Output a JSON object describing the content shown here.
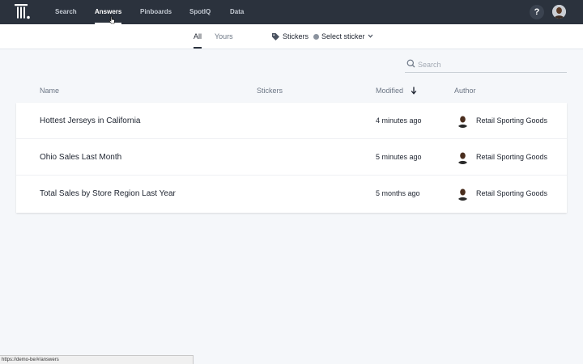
{
  "topnav": {
    "items": [
      {
        "label": "Search",
        "active": false
      },
      {
        "label": "Answers",
        "active": true
      },
      {
        "label": "Pinboards",
        "active": false
      },
      {
        "label": "SpotIQ",
        "active": false
      },
      {
        "label": "Data",
        "active": false
      }
    ],
    "help_label": "?",
    "icons": {
      "logo": "thoughtspot-logo",
      "help": "help-icon",
      "user": "user-avatar"
    }
  },
  "subnav": {
    "tabs": [
      {
        "label": "All",
        "active": true
      },
      {
        "label": "Yours",
        "active": false
      }
    ],
    "stickers_label": "Stickers",
    "select_sticker_label": "Select sticker"
  },
  "search": {
    "placeholder": "Search",
    "value": ""
  },
  "table": {
    "columns": {
      "name": "Name",
      "stickers": "Stickers",
      "modified": "Modified",
      "author": "Author"
    },
    "sort": {
      "column": "Modified",
      "direction": "descending"
    },
    "rows": [
      {
        "name": "Hottest Jerseys in California",
        "stickers": "",
        "modified": "4 minutes ago",
        "author": "Retail Sporting Goods"
      },
      {
        "name": "Ohio Sales Last Month",
        "stickers": "",
        "modified": "5 minutes ago",
        "author": "Retail Sporting Goods"
      },
      {
        "name": "Total Sales by Store Region Last Year",
        "stickers": "",
        "modified": "5 months ago",
        "author": "Retail Sporting Goods"
      }
    ]
  },
  "status_bar": {
    "url": "https://demo-be/#/answers"
  },
  "colors": {
    "nav_bg": "#2b323d",
    "page_bg": "#f5f7fa",
    "accent_underline": "#ffffff"
  }
}
